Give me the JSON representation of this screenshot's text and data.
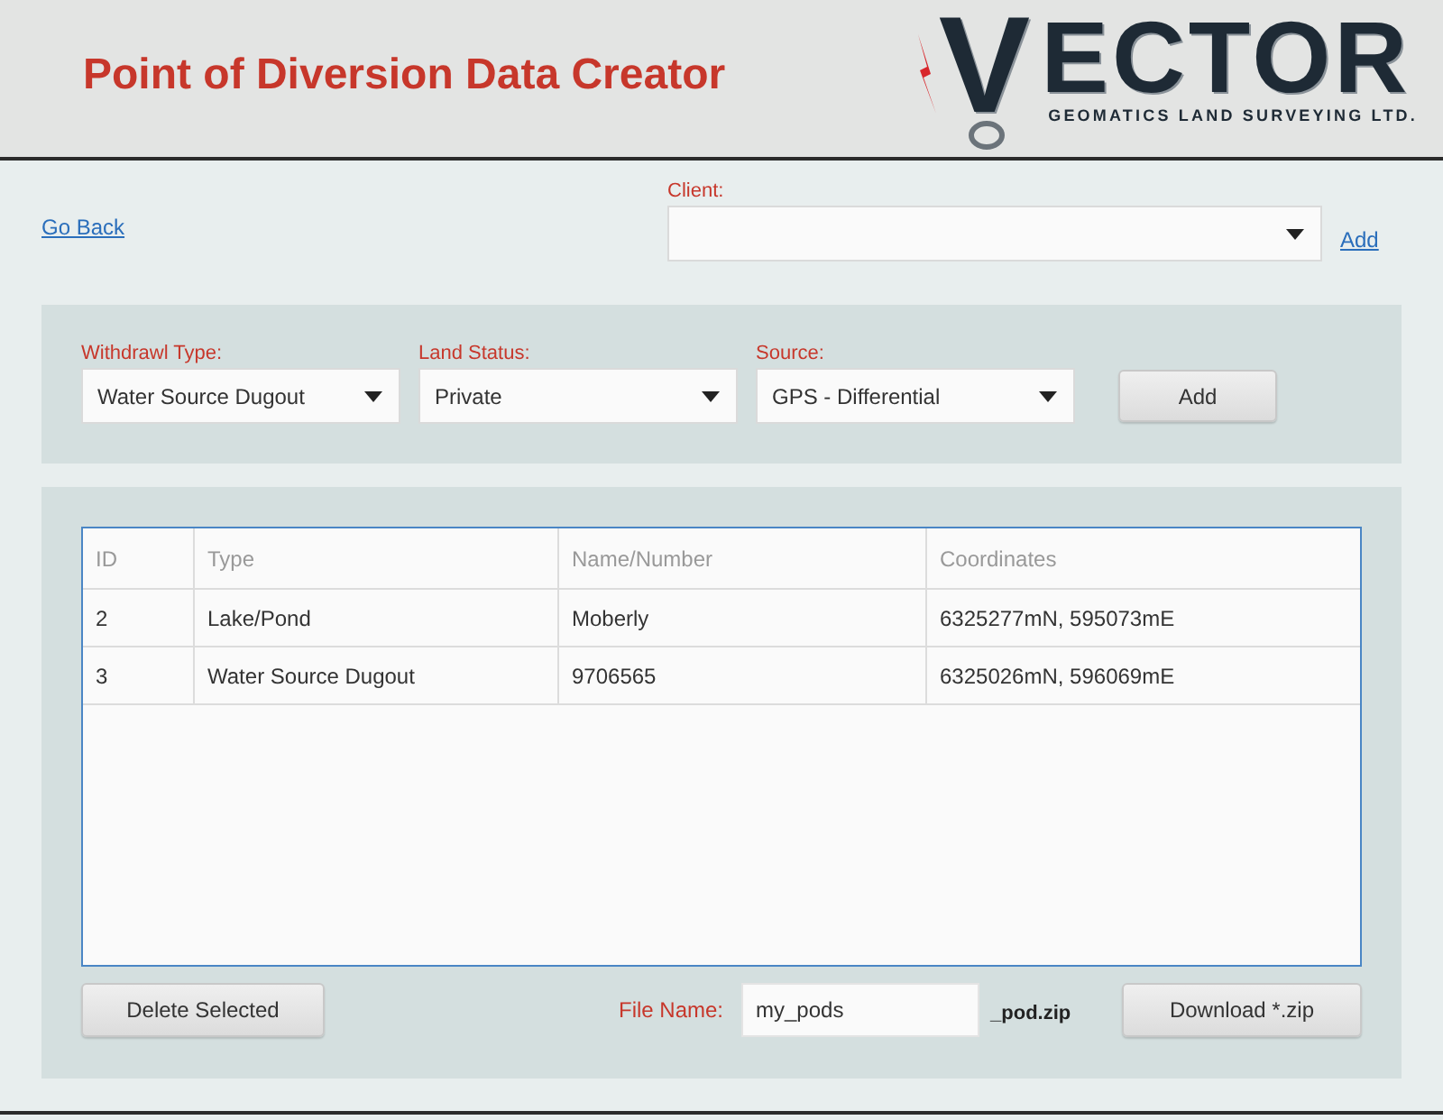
{
  "header": {
    "title": "Point of Diversion Data Creator",
    "logo": {
      "mark": "V",
      "wordmark": "ECTOR",
      "tagline": "GEOMATICS LAND SURVEYING LTD."
    }
  },
  "nav": {
    "back_link": "Go Back"
  },
  "client": {
    "label": "Client:",
    "add_link": "Add"
  },
  "filters": {
    "fields": [
      {
        "label": "Withdrawl Type:",
        "value": "Water Source Dugout"
      },
      {
        "label": "Land Status:",
        "value": "Private"
      },
      {
        "label": "Source:",
        "value": "GPS - Differential"
      }
    ],
    "add_button": "Add"
  },
  "table": {
    "columns": [
      "ID",
      "Type",
      "Name/Number",
      "Coordinates"
    ],
    "rows": [
      {
        "selected": false,
        "cells": [
          "2",
          "Lake/Pond",
          "Moberly",
          "6325277mN, 595073mE"
        ]
      },
      {
        "selected": false,
        "cells": [
          "3",
          "Water Source Dugout",
          "9706565",
          "6325026mN, 596069mE"
        ]
      }
    ]
  },
  "footer": {
    "delete_button": "Delete Selected",
    "file_name": {
      "label": "File Name:",
      "value": "my_pods",
      "suffix": "_pod.zip"
    },
    "download_button": "Download *.zip"
  }
}
